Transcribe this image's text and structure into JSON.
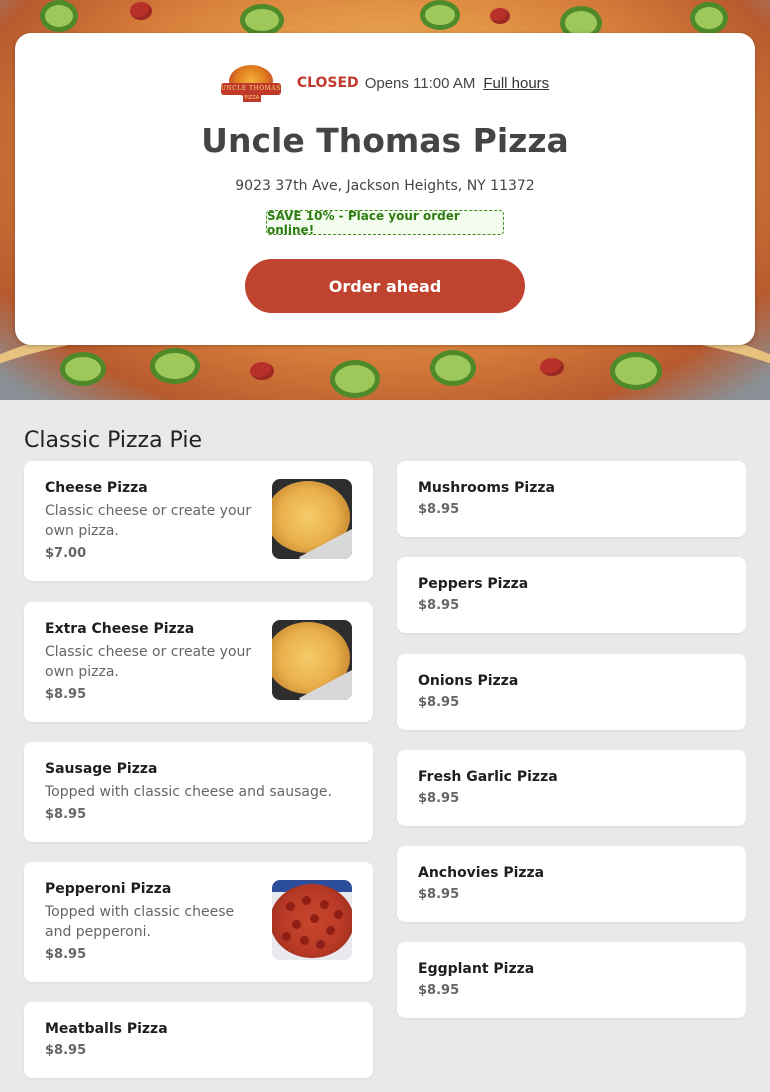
{
  "header": {
    "logo_text": "UNCLE THOMAS",
    "logo_subtext": "PIZZA",
    "status": "CLOSED",
    "opens_text": "Opens 11:00 AM",
    "hours_link": "Full hours",
    "restaurant_name": "Uncle Thomas Pizza",
    "address": "9023 37th Ave, Jackson Heights, NY 11372",
    "promo": "SAVE 10% - Place your order online!",
    "order_button": "Order ahead"
  },
  "colors": {
    "accent": "#c0432f",
    "closed": "#c0392b",
    "promo_green": "#2e7d12",
    "page_bg": "#e9e9e9"
  },
  "menu": {
    "section_title": "Classic Pizza Pie",
    "left_items": [
      {
        "name": "Cheese Pizza",
        "description": "Classic cheese or create your own pizza.",
        "price": "$7.00",
        "image": "cheese-pizza-photo"
      },
      {
        "name": "Extra Cheese Pizza",
        "description": "Classic cheese or create your own pizza.",
        "price": "$8.95",
        "image": "cheese-pizza-photo"
      },
      {
        "name": "Sausage Pizza",
        "description": "Topped with classic cheese and sausage.",
        "price": "$8.95"
      },
      {
        "name": "Pepperoni Pizza",
        "description": "Topped with classic cheese and pepperoni.",
        "price": "$8.95",
        "image": "pepperoni-pizza-photo"
      },
      {
        "name": "Meatballs Pizza",
        "price": "$8.95"
      }
    ],
    "right_items": [
      {
        "name": "Mushrooms Pizza",
        "price": "$8.95"
      },
      {
        "name": "Peppers Pizza",
        "price": "$8.95"
      },
      {
        "name": "Onions Pizza",
        "price": "$8.95"
      },
      {
        "name": "Fresh Garlic Pizza",
        "price": "$8.95"
      },
      {
        "name": "Anchovies Pizza",
        "price": "$8.95"
      },
      {
        "name": "Eggplant Pizza",
        "price": "$8.95"
      }
    ]
  }
}
